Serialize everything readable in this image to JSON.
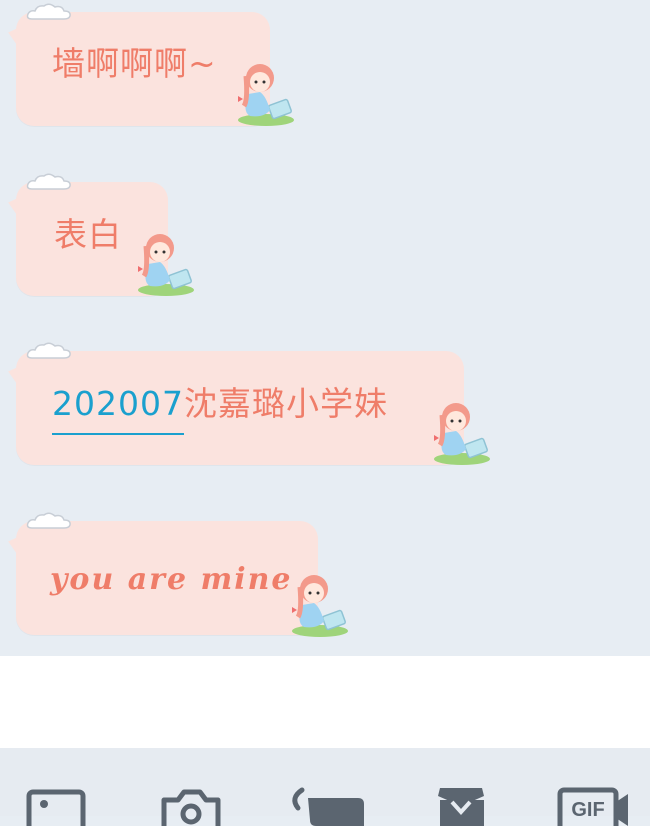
{
  "messages": [
    {
      "text": "墙啊啊啊~"
    },
    {
      "text": "表白"
    },
    {
      "link_text": "202007",
      "text": "沈嘉璐小学妹"
    },
    {
      "text": "you are mine"
    }
  ],
  "input": {
    "value": ""
  },
  "toolbar": {
    "icons": [
      "image-icon",
      "camera-icon",
      "voice-icon",
      "red-packet-icon",
      "gif-icon"
    ],
    "gif_label": "GIF"
  },
  "colors": {
    "chat_background": "#e7edf3",
    "bubble": "#fbe3de",
    "bubble_text": "#ef7d69",
    "link_text": "#1aa0ce",
    "toolbar_background": "#e6ebf1",
    "icon": "#5b6570"
  }
}
